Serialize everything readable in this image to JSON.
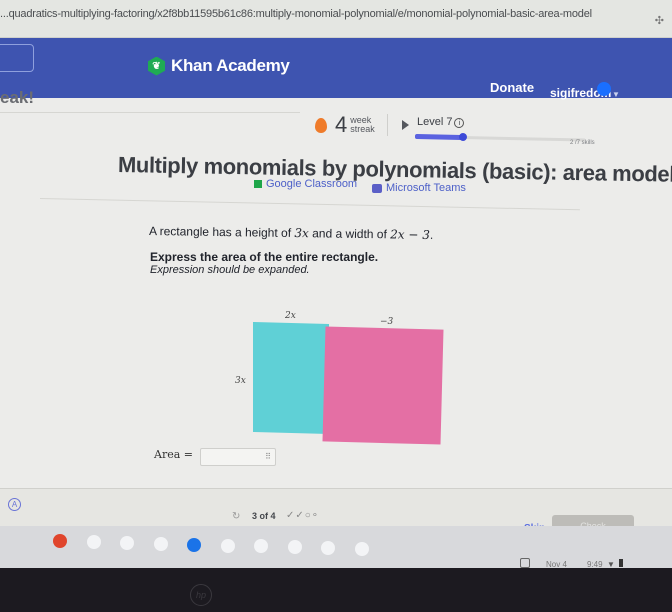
{
  "browser": {
    "url": "...quadratics-multiplying-factoring/x2f8bb11595b61c86:multiply-monomial-polynomial/e/monomial-polynomial-basic-area-model",
    "extension_icon": "puzzle-icon"
  },
  "header": {
    "brand": "Khan Academy",
    "donate": "Donate",
    "username": "sigifredom"
  },
  "banner_fragment": "eak!",
  "progress": {
    "streak_count": "4",
    "streak_label_1": "week",
    "streak_label_2": "streak",
    "level_label": "Level 7",
    "level_progress_fraction": 0.28,
    "skills_text": "2 /7 skills"
  },
  "exercise": {
    "title": "Multiply monomials by polynomials (basic): area model",
    "share_google": "Google Classroom",
    "share_teams": "Microsoft Teams",
    "question_pre": "A rectangle has a height of ",
    "height_expr": "3x",
    "question_mid": " and a width of ",
    "width_expr": "2x − 3",
    "question_end": ".",
    "instruction": "Express the area of the entire rectangle.",
    "note": "Expression should be expanded.",
    "area_model": {
      "top_left_label": "2x",
      "top_right_label": "−3",
      "side_label": "3x",
      "left_color": "#5fd0d6",
      "right_color": "#e46fa4"
    },
    "answer_label": "Area =",
    "answer_value": "",
    "keypad_icon": "⠿"
  },
  "footer": {
    "progress_text": "3 of 4",
    "progress_marks": "✓✓○∘",
    "skip": "Skip",
    "check": "Check"
  },
  "shelf": {
    "apps": [
      {
        "name": "chrome",
        "color": "#e0452c"
      },
      {
        "name": "assistant",
        "color": "#f3f4f6"
      },
      {
        "name": "gmail",
        "color": "#f3f4f6"
      },
      {
        "name": "slides",
        "color": "#f3f4f6"
      },
      {
        "name": "files",
        "color": "#1a73e8"
      },
      {
        "name": "messages",
        "color": "#f3f4f6"
      },
      {
        "name": "meet",
        "color": "#f3f4f6"
      },
      {
        "name": "play-store",
        "color": "#f3f4f6"
      },
      {
        "name": "youtube",
        "color": "#f3f4f6"
      },
      {
        "name": "photos",
        "color": "#f3f4f6"
      }
    ],
    "date": "Nov 4",
    "time": "9:49"
  },
  "bezel_logo": "hp"
}
